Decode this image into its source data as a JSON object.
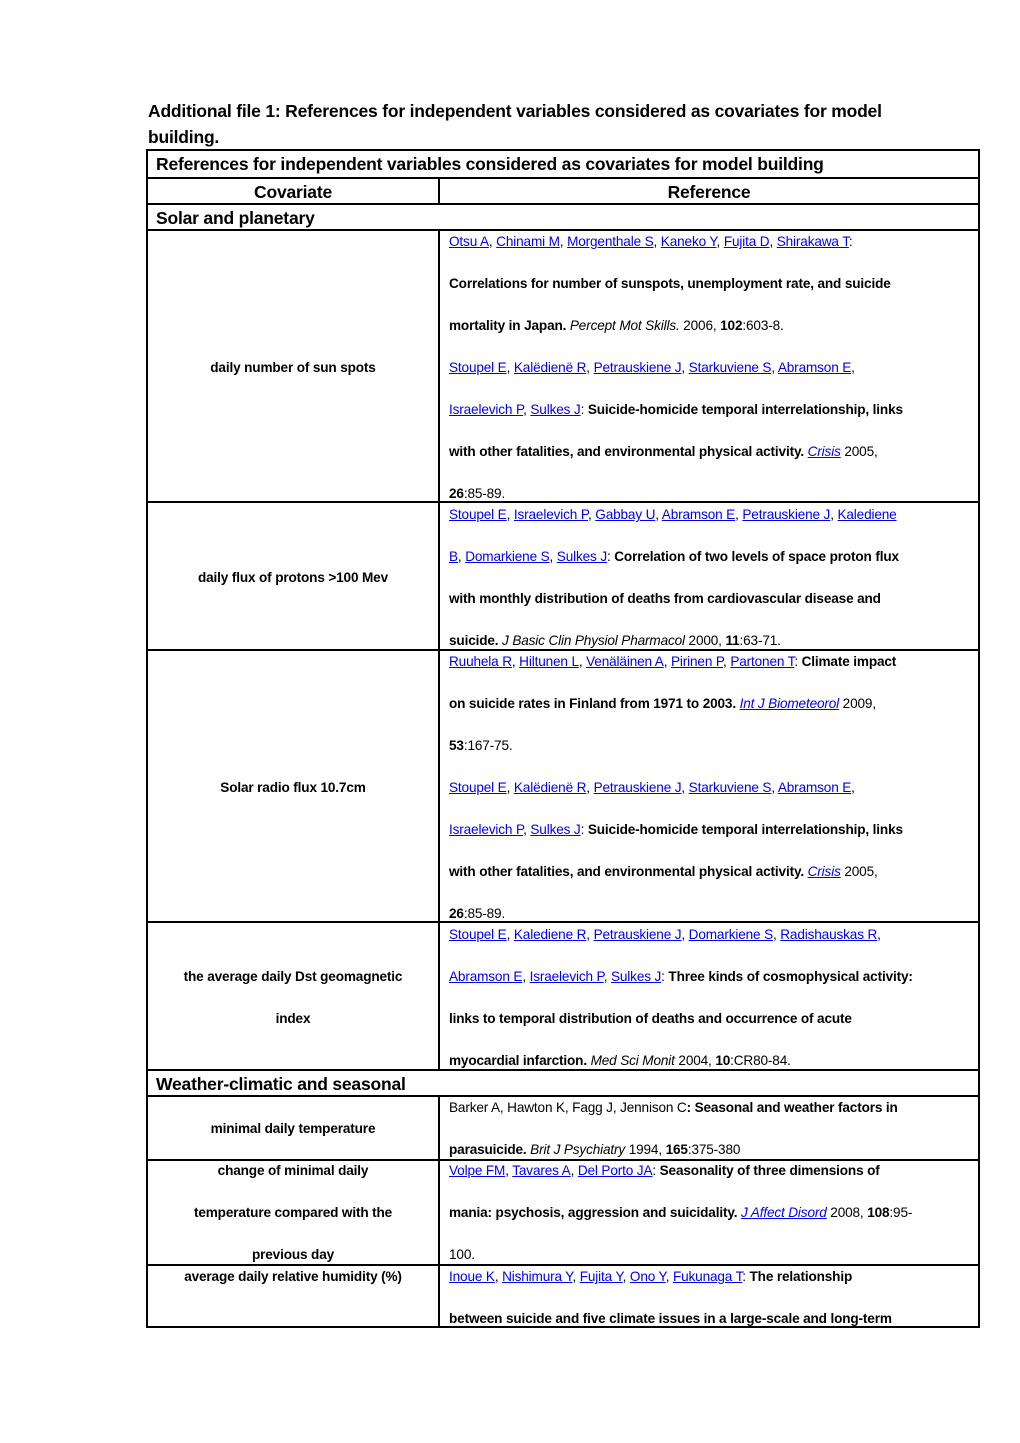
{
  "document": {
    "title_line1": "Additional file 1: References for independent variables considered as covariates for model",
    "title_line2": "building."
  },
  "table": {
    "caption": "References for independent variables considered as covariates for model building",
    "headers": {
      "covariate": "Covariate",
      "reference": "Reference"
    },
    "sections": [
      {
        "title": "Solar and planetary"
      },
      {
        "title": "Weather-climatic and seasonal"
      }
    ],
    "rows": [
      {
        "covariate_lines": [
          "daily number of sun spots"
        ],
        "reference_lines": [
          [
            {
              "t": "Otsu A",
              "s": "link"
            },
            {
              "t": ", ",
              "s": "plain"
            },
            {
              "t": "Chinami M",
              "s": "link"
            },
            {
              "t": ", ",
              "s": "plain"
            },
            {
              "t": "Morgenthale S",
              "s": "link"
            },
            {
              "t": ", ",
              "s": "plain"
            },
            {
              "t": "Kaneko Y",
              "s": "link"
            },
            {
              "t": ", ",
              "s": "plain"
            },
            {
              "t": "Fujita D",
              "s": "link"
            },
            {
              "t": ", ",
              "s": "plain"
            },
            {
              "t": "Shirakawa T",
              "s": "link"
            },
            {
              "t": ":",
              "s": "plain"
            }
          ],
          [
            {
              "t": "Correlations for number of sunspots, unemployment rate, and suicide",
              "s": "bold"
            }
          ],
          [
            {
              "t": "mortality in Japan. ",
              "s": "bold"
            },
            {
              "t": "Percept Mot Skills.",
              "s": "italic"
            },
            {
              "t": " 2006, ",
              "s": "plain"
            },
            {
              "t": "102",
              "s": "bold"
            },
            {
              "t": ":603-8.",
              "s": "plain"
            }
          ],
          [
            {
              "t": "Stoupel E",
              "s": "link"
            },
            {
              "t": ", ",
              "s": "plain"
            },
            {
              "t": "Kalëdienë R",
              "s": "link"
            },
            {
              "t": ", ",
              "s": "plain"
            },
            {
              "t": "Petrauskiene J",
              "s": "link"
            },
            {
              "t": ", ",
              "s": "plain"
            },
            {
              "t": "Starkuviene S",
              "s": "link"
            },
            {
              "t": ", ",
              "s": "plain"
            },
            {
              "t": "Abramson E",
              "s": "link"
            },
            {
              "t": ",",
              "s": "plain"
            }
          ],
          [
            {
              "t": "Israelevich P",
              "s": "link"
            },
            {
              "t": ", ",
              "s": "plain"
            },
            {
              "t": "Sulkes J",
              "s": "link"
            },
            {
              "t": ": ",
              "s": "plain"
            },
            {
              "t": "Suicide-homicide temporal interrelationship, links",
              "s": "bold"
            }
          ],
          [
            {
              "t": "with other fatalities, and environmental physical activity. ",
              "s": "bold"
            },
            {
              "t": "Crisis",
              "s": "italic-link"
            },
            {
              "t": " 2005,",
              "s": "plain"
            }
          ],
          [
            {
              "t": "26",
              "s": "bold"
            },
            {
              "t": ":85-89.",
              "s": "plain"
            }
          ]
        ]
      },
      {
        "covariate_lines": [
          "daily flux of protons >100 Mev"
        ],
        "reference_lines": [
          [
            {
              "t": "Stoupel E",
              "s": "link"
            },
            {
              "t": ", ",
              "s": "plain"
            },
            {
              "t": "Israelevich P",
              "s": "link"
            },
            {
              "t": ", ",
              "s": "plain"
            },
            {
              "t": "Gabbay U",
              "s": "link"
            },
            {
              "t": ", ",
              "s": "plain"
            },
            {
              "t": "Abramson E",
              "s": "link"
            },
            {
              "t": ", ",
              "s": "plain"
            },
            {
              "t": "Petrauskiene J",
              "s": "link"
            },
            {
              "t": ", ",
              "s": "plain"
            },
            {
              "t": "Kalediene ",
              "s": "link"
            }
          ],
          [
            {
              "t": "B",
              "s": "link"
            },
            {
              "t": ", ",
              "s": "plain"
            },
            {
              "t": "Domarkiene S",
              "s": "link"
            },
            {
              "t": ", ",
              "s": "plain"
            },
            {
              "t": "Sulkes J",
              "s": "link"
            },
            {
              "t": ": ",
              "s": "plain"
            },
            {
              "t": "Correlation of two levels of space proton flux",
              "s": "bold"
            }
          ],
          [
            {
              "t": "with monthly distribution of deaths from cardiovascular disease and",
              "s": "bold"
            }
          ],
          [
            {
              "t": "suicide. ",
              "s": "bold"
            },
            {
              "t": "J Basic Clin Physiol Pharmacol",
              "s": "italic"
            },
            {
              "t": " 2000, ",
              "s": "plain"
            },
            {
              "t": "11",
              "s": "bold"
            },
            {
              "t": ":63-71.",
              "s": "plain"
            }
          ]
        ]
      },
      {
        "covariate_lines": [
          "Solar radio flux 10.7cm"
        ],
        "reference_lines": [
          [
            {
              "t": "Ruuhela R",
              "s": "link"
            },
            {
              "t": ", ",
              "s": "plain"
            },
            {
              "t": "Hiltunen L",
              "s": "link"
            },
            {
              "t": ", ",
              "s": "plain"
            },
            {
              "t": "Venäläinen A",
              "s": "link"
            },
            {
              "t": ", ",
              "s": "plain"
            },
            {
              "t": "Pirinen P",
              "s": "link"
            },
            {
              "t": ", ",
              "s": "plain"
            },
            {
              "t": "Partonen T",
              "s": "link"
            },
            {
              "t": ": ",
              "s": "plain"
            },
            {
              "t": "Climate impact",
              "s": "bold"
            }
          ],
          [
            {
              "t": "on suicide rates in Finland from 1971 to 2003. ",
              "s": "bold"
            },
            {
              "t": "Int J Biometeorol",
              "s": "italic-link"
            },
            {
              "t": " 2009,",
              "s": "plain"
            }
          ],
          [
            {
              "t": "53",
              "s": "bold"
            },
            {
              "t": ":167-75.",
              "s": "plain"
            }
          ],
          [
            {
              "t": "Stoupel E",
              "s": "link"
            },
            {
              "t": ", ",
              "s": "plain"
            },
            {
              "t": "Kalëdienë R",
              "s": "link"
            },
            {
              "t": ", ",
              "s": "plain"
            },
            {
              "t": "Petrauskiene J",
              "s": "link"
            },
            {
              "t": ", ",
              "s": "plain"
            },
            {
              "t": "Starkuviene S",
              "s": "link"
            },
            {
              "t": ", ",
              "s": "plain"
            },
            {
              "t": "Abramson E",
              "s": "link"
            },
            {
              "t": ",",
              "s": "plain"
            }
          ],
          [
            {
              "t": "Israelevich P",
              "s": "link"
            },
            {
              "t": ", ",
              "s": "plain"
            },
            {
              "t": "Sulkes J",
              "s": "link"
            },
            {
              "t": ": ",
              "s": "plain"
            },
            {
              "t": "Suicide-homicide temporal interrelationship, links",
              "s": "bold"
            }
          ],
          [
            {
              "t": "with other fatalities, and environmental physical activity. ",
              "s": "bold"
            },
            {
              "t": "Crisis",
              "s": "italic-link"
            },
            {
              "t": " 2005,",
              "s": "plain"
            }
          ],
          [
            {
              "t": "26",
              "s": "bold"
            },
            {
              "t": ":85-89.",
              "s": "plain"
            }
          ]
        ]
      },
      {
        "covariate_lines": [
          "the average daily Dst geomagnetic",
          "index"
        ],
        "reference_lines": [
          [
            {
              "t": "Stoupel E",
              "s": "link"
            },
            {
              "t": ", ",
              "s": "plain"
            },
            {
              "t": "Kalediene R",
              "s": "link"
            },
            {
              "t": ", ",
              "s": "plain"
            },
            {
              "t": "Petrauskiene J",
              "s": "link"
            },
            {
              "t": ", ",
              "s": "plain"
            },
            {
              "t": "Domarkiene S",
              "s": "link"
            },
            {
              "t": ", ",
              "s": "plain"
            },
            {
              "t": "Radishauskas R",
              "s": "link"
            },
            {
              "t": ",",
              "s": "plain"
            }
          ],
          [
            {
              "t": "Abramson E",
              "s": "link"
            },
            {
              "t": ", ",
              "s": "plain"
            },
            {
              "t": "Israelevich P",
              "s": "link"
            },
            {
              "t": ", ",
              "s": "plain"
            },
            {
              "t": "Sulkes J",
              "s": "link"
            },
            {
              "t": ": ",
              "s": "plain"
            },
            {
              "t": "Three kinds of cosmophysical activity:",
              "s": "bold"
            }
          ],
          [
            {
              "t": "links to temporal distribution of deaths and occurrence of acute",
              "s": "bold"
            }
          ],
          [
            {
              "t": "myocardial infarction. ",
              "s": "bold"
            },
            {
              "t": "Med Sci Monit",
              "s": "italic"
            },
            {
              "t": " 2004, ",
              "s": "plain"
            },
            {
              "t": "10",
              "s": "bold"
            },
            {
              "t": ":CR80-84.",
              "s": "plain"
            }
          ]
        ]
      },
      {
        "covariate_lines": [
          "minimal daily temperature"
        ],
        "reference_lines": [
          [
            {
              "t": "Barker A, Hawton K, Fagg J, Jennison C",
              "s": "plain"
            },
            {
              "t": ": Seasonal and weather factors in",
              "s": "bold"
            }
          ],
          [
            {
              "t": "parasuicide. ",
              "s": "bold"
            },
            {
              "t": "Brit J Psychiatry",
              "s": "italic"
            },
            {
              "t": " 1994, ",
              "s": "plain"
            },
            {
              "t": "165",
              "s": "bold"
            },
            {
              "t": ":375-380",
              "s": "plain"
            }
          ]
        ]
      },
      {
        "covariate_lines": [
          "change of minimal daily",
          "temperature compared with the",
          "previous day"
        ],
        "reference_lines": [
          [
            {
              "t": "Volpe FM",
              "s": "link"
            },
            {
              "t": ", ",
              "s": "plain"
            },
            {
              "t": "Tavares A",
              "s": "link"
            },
            {
              "t": ", ",
              "s": "plain"
            },
            {
              "t": "Del Porto JA",
              "s": "link"
            },
            {
              "t": ": ",
              "s": "plain"
            },
            {
              "t": "Seasonality of three dimensions of",
              "s": "bold"
            }
          ],
          [
            {
              "t": "mania: psychosis, aggression and suicidality. ",
              "s": "bold"
            },
            {
              "t": "J Affect Disord",
              "s": "italic-link"
            },
            {
              "t": " 2008, ",
              "s": "plain"
            },
            {
              "t": "108",
              "s": "bold"
            },
            {
              "t": ":95-",
              "s": "plain"
            }
          ],
          [
            {
              "t": "100.",
              "s": "plain"
            }
          ]
        ]
      },
      {
        "covariate_lines": [
          "average daily relative humidity (%)"
        ],
        "reference_lines": [
          [
            {
              "t": "Inoue K",
              "s": "link"
            },
            {
              "t": ", ",
              "s": "plain"
            },
            {
              "t": "Nishimura Y",
              "s": "link"
            },
            {
              "t": ", ",
              "s": "plain"
            },
            {
              "t": "Fujita Y",
              "s": "link"
            },
            {
              "t": ", ",
              "s": "plain"
            },
            {
              "t": "Ono Y",
              "s": "link"
            },
            {
              "t": ", ",
              "s": "plain"
            },
            {
              "t": "Fukunaga T",
              "s": "link"
            },
            {
              "t": ": ",
              "s": "plain"
            },
            {
              "t": "The relationship",
              "s": "bold"
            }
          ],
          [
            {
              "t": "between suicide and five climate issues in a large-scale and long-term",
              "s": "bold"
            }
          ]
        ]
      }
    ]
  },
  "colors": {
    "link": "#0000ee",
    "text": "#000000",
    "border": "#000000"
  }
}
